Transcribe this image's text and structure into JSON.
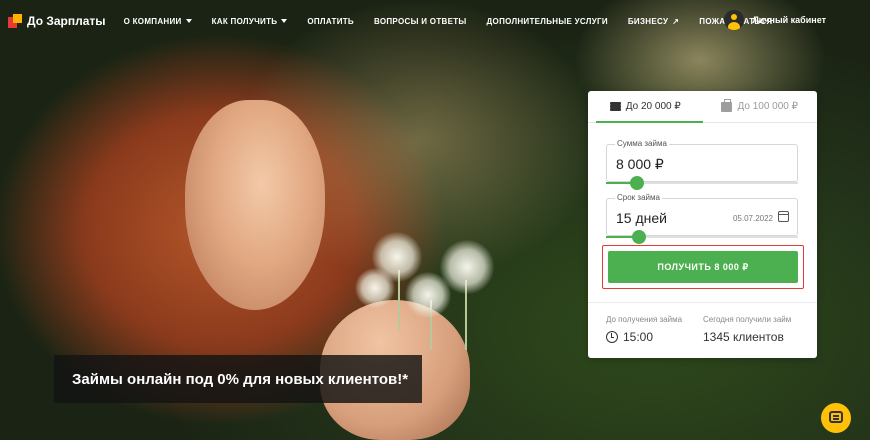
{
  "header": {
    "logo_text": "До Зарплаты",
    "nav": [
      {
        "label": "О КОМПАНИИ",
        "dropdown": true
      },
      {
        "label": "КАК ПОЛУЧИТЬ",
        "dropdown": true
      },
      {
        "label": "ОПЛАТИТЬ",
        "dropdown": false
      },
      {
        "label": "ВОПРОСЫ И ОТВЕТЫ",
        "dropdown": false
      },
      {
        "label": "ДОПОЛНИТЕЛЬНЫЕ УСЛУГИ",
        "dropdown": false
      },
      {
        "label": "БИЗНЕСУ",
        "dropdown": false,
        "external": true
      },
      {
        "label": "ПОЖАЛОВАТЬСЯ",
        "dropdown": false
      }
    ],
    "account_label": "Личный кабинет"
  },
  "loan_form": {
    "tabs": [
      {
        "label": "До 20 000 ₽",
        "active": true,
        "icon": "coins-icon"
      },
      {
        "label": "До 100 000 ₽",
        "active": false,
        "icon": "briefcase-icon"
      }
    ],
    "amount": {
      "label": "Сумма займа",
      "value": "8 000 ₽",
      "slider_fraction": 0.16
    },
    "term": {
      "label": "Срок займа",
      "value": "15 дней",
      "date": "05.07.2022",
      "slider_fraction": 0.17
    },
    "cta_label": "ПОЛУЧИТЬ 8 000 ₽",
    "info": [
      {
        "label": "До получения займа",
        "value": "15:00",
        "icon": "clock-icon"
      },
      {
        "label": "Сегодня получили займ",
        "value": "1345 клиентов"
      }
    ]
  },
  "promo_text": "Займы онлайн под 0% для новых клиентов!*",
  "colors": {
    "accent": "#4caf50",
    "highlight": "#e53935",
    "chat": "#ffc107"
  }
}
